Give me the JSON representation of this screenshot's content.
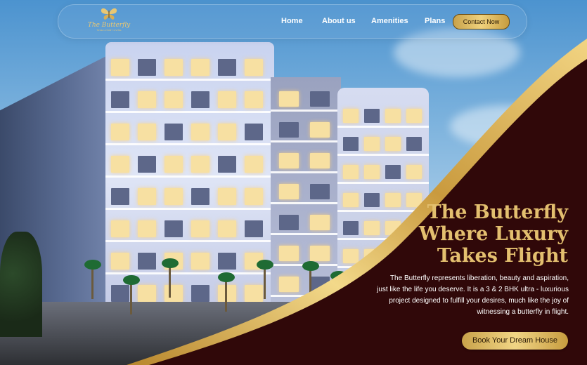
{
  "brand": {
    "name": "The Butterfly",
    "tagline": "TRUE LUXURY LIVING",
    "colors": {
      "gold": "#e3bf6f",
      "maroon": "#300809",
      "sky": "#7fb4de"
    }
  },
  "nav": {
    "links": [
      "Home",
      "About us",
      "Amenities",
      "Plans"
    ],
    "contact_label": "Contact Now"
  },
  "hero": {
    "headline": [
      "The Butterfly",
      "Where Luxury",
      "Takes Flight"
    ],
    "description": [
      "The Butterfly represents liberation, beauty and aspiration,",
      "just like the life you deserve. It is a 3 & 2 BHK ultra - luxurious",
      "project designed to fulfill your desires, much like the joy of",
      "witnessing a butterfly in flight."
    ],
    "cta_label": "Book Your Dream House"
  },
  "icons": [
    "butterfly-logo-icon"
  ]
}
